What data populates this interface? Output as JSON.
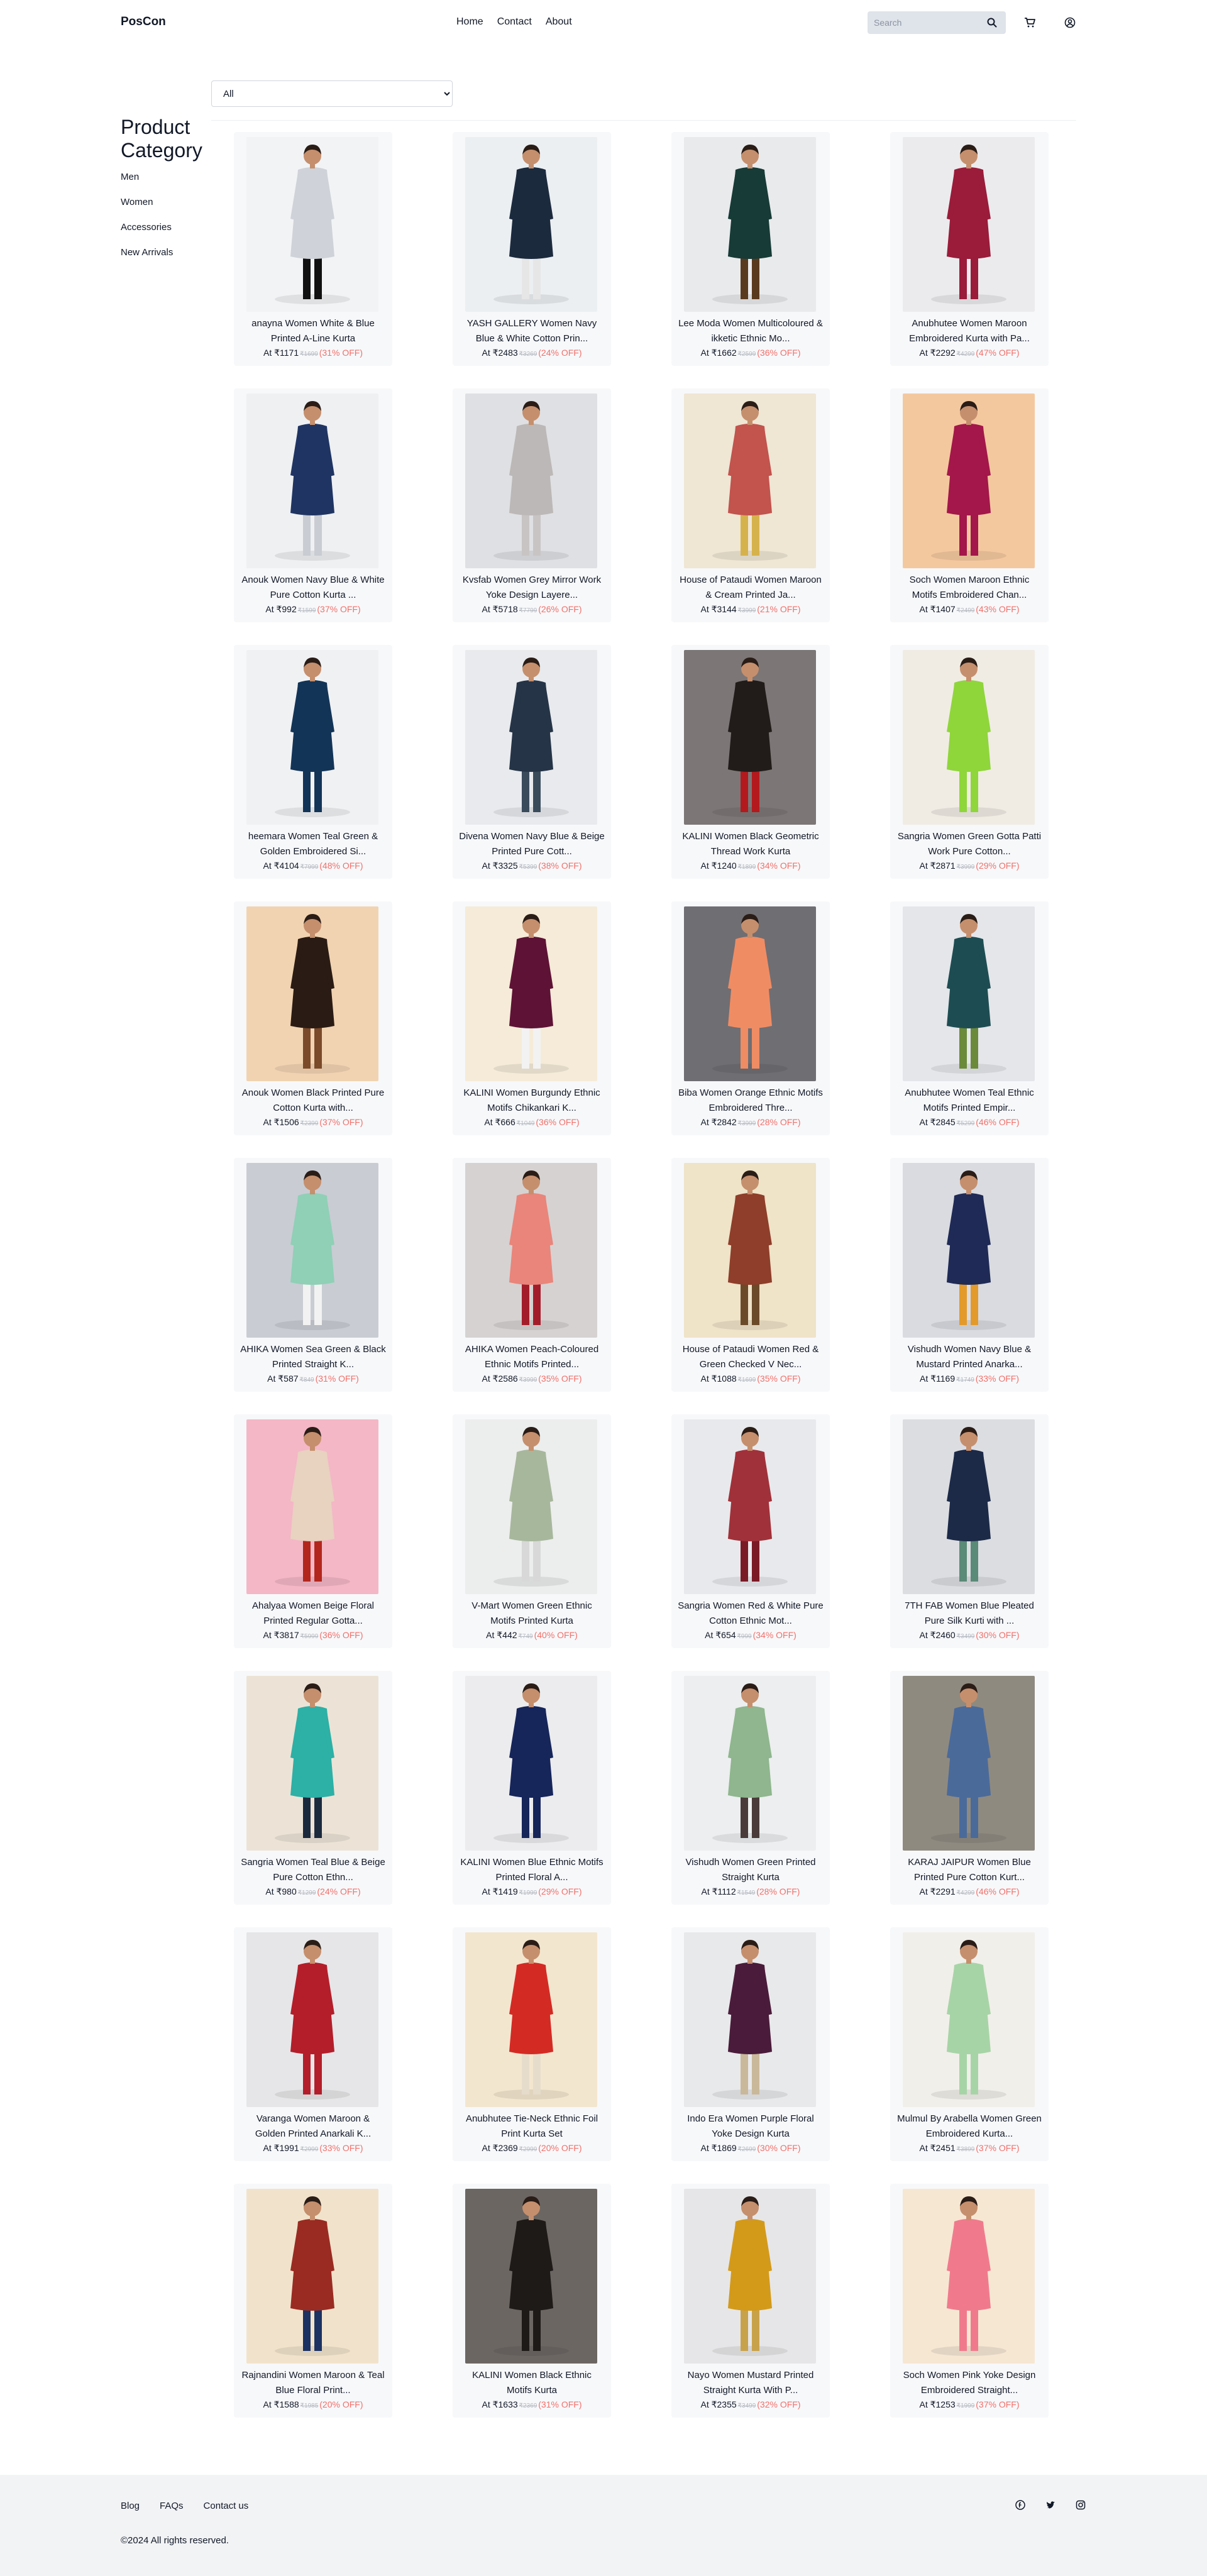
{
  "header": {
    "brand": "PosCon",
    "nav": [
      "Home",
      "Contact",
      "About"
    ],
    "search_placeholder": "Search",
    "icons": [
      "search-icon",
      "cart-icon",
      "user-icon"
    ]
  },
  "filter": {
    "selected": "All"
  },
  "sidebar": {
    "title": "Product Category",
    "items": [
      "Men",
      "Women",
      "Accessories",
      "New Arrivals"
    ]
  },
  "products": [
    {
      "title": "anayna Women White & Blue Printed A-Line Kurta",
      "price": "At ₹1171",
      "mrp": "₹1699",
      "off": "(31% OFF)",
      "colors": [
        "#f2f3f5",
        "#cfd2d8",
        "#111111"
      ]
    },
    {
      "title": "YASH GALLERY Women Navy Blue & White Cotton Prin...",
      "price": "At ₹2483",
      "mrp": "₹3269",
      "off": "(24% OFF)",
      "colors": [
        "#eceff2",
        "#1c2a3e",
        "#e6e6e6"
      ]
    },
    {
      "title": "Lee Moda Women Multicoloured & ikketic Ethnic Mo...",
      "price": "At ₹1662",
      "mrp": "₹2599",
      "off": "(36% OFF)",
      "colors": [
        "#e9eaec",
        "#173b37",
        "#5a3a1e"
      ]
    },
    {
      "title": "Anubhutee Women Maroon Embroidered Kurta with Pa...",
      "price": "At ₹2292",
      "mrp": "₹4299",
      "off": "(47% OFF)",
      "colors": [
        "#ebebed",
        "#9a1b3a",
        "#9a1b3a"
      ]
    },
    {
      "title": "Anouk Women Navy Blue & White Pure Cotton Kurta ...",
      "price": "At ₹992",
      "mrp": "₹1599",
      "off": "(37% OFF)",
      "colors": [
        "#eef0f2",
        "#1f3462",
        "#c9ccd2"
      ]
    },
    {
      "title": "Kvsfab Women Grey Mirror Work Yoke Design Layere...",
      "price": "At ₹5718",
      "mrp": "₹7799",
      "off": "(26% OFF)",
      "colors": [
        "#dfe0e3",
        "#bcb8b7",
        "#c8c4c4"
      ]
    },
    {
      "title": "House of Pataudi Women Maroon & Cream Printed Ja...",
      "price": "At ₹3144",
      "mrp": "₹3999",
      "off": "(21% OFF)",
      "colors": [
        "#efe6d4",
        "#c2534d",
        "#d6b24c"
      ]
    },
    {
      "title": "Soch Women Maroon Ethnic Motifs Embroidered Chan...",
      "price": "At ₹1407",
      "mrp": "₹2499",
      "off": "(43% OFF)",
      "colors": [
        "#f4c89f",
        "#a3174a",
        "#a3174a"
      ]
    },
    {
      "title": "heemara Women Teal Green & Golden Embroidered Si...",
      "price": "At ₹4104",
      "mrp": "₹7999",
      "off": "(48% OFF)",
      "colors": [
        "#f0f1f3",
        "#123457",
        "#123457"
      ]
    },
    {
      "title": "Divena Women Navy Blue & Beige Printed Pure Cott...",
      "price": "At ₹3325",
      "mrp": "₹5399",
      "off": "(38% OFF)",
      "colors": [
        "#e8eaed",
        "#253447",
        "#3a4b5c"
      ]
    },
    {
      "title": "KALINI Women Black Geometric Thread Work Kurta",
      "price": "At ₹1240",
      "mrp": "₹1899",
      "off": "(34% OFF)",
      "colors": [
        "#7c7676",
        "#211c1a",
        "#b3191d"
      ]
    },
    {
      "title": "Sangria Women Green Gotta Patti Work Pure Cotton...",
      "price": "At ₹2871",
      "mrp": "₹3999",
      "off": "(29% OFF)",
      "colors": [
        "#f0ece4",
        "#8fd63a",
        "#8fd63a"
      ]
    },
    {
      "title": "Anouk Women Black Printed Pure Cotton Kurta with...",
      "price": "At ₹1506",
      "mrp": "₹2399",
      "off": "(37% OFF)",
      "colors": [
        "#f1d3b1",
        "#2a1b14",
        "#7b4a2a"
      ]
    },
    {
      "title": "KALINI Women Burgundy Ethnic Motifs Chikankari K...",
      "price": "At ₹666",
      "mrp": "₹1049",
      "off": "(36% OFF)",
      "colors": [
        "#f5ebd8",
        "#5e1235",
        "#f2f2f2"
      ]
    },
    {
      "title": "Biba Women Orange Ethnic Motifs Embroidered Thre...",
      "price": "At ₹2842",
      "mrp": "₹3999",
      "off": "(28% OFF)",
      "colors": [
        "#6f6e73",
        "#f08c63",
        "#f08c63"
      ]
    },
    {
      "title": "Anubhutee Women Teal Ethnic Motifs Printed Empir...",
      "price": "At ₹2845",
      "mrp": "₹5299",
      "off": "(46% OFF)",
      "colors": [
        "#e4e6ea",
        "#1d4d52",
        "#6b8a3a"
      ]
    },
    {
      "title": "AHIKA Women Sea Green & Black Printed Straight K...",
      "price": "At ₹587",
      "mrp": "₹849",
      "off": "(31% OFF)",
      "colors": [
        "#c9ccd3",
        "#8fd0b6",
        "#f2f2f2"
      ]
    },
    {
      "title": "AHIKA Women Peach-Coloured Ethnic Motifs Printed...",
      "price": "At ₹2586",
      "mrp": "₹3999",
      "off": "(35% OFF)",
      "colors": [
        "#d6d2d2",
        "#e9857a",
        "#a31c2a"
      ]
    },
    {
      "title": "House of Pataudi Women Red & Green Checked V Nec...",
      "price": "At ₹1088",
      "mrp": "₹1699",
      "off": "(35% OFF)",
      "colors": [
        "#efe3c8",
        "#8e3e2a",
        "#6b4a2a"
      ]
    },
    {
      "title": "Vishudh Women Navy Blue & Mustard Printed Anarka...",
      "price": "At ₹1169",
      "mrp": "₹1749",
      "off": "(33% OFF)",
      "colors": [
        "#d9dbe0",
        "#1f2a56",
        "#e39a2a"
      ]
    },
    {
      "title": "Ahalyaa Women Beige Floral Printed Regular Gotta...",
      "price": "At ₹3817",
      "mrp": "₹5999",
      "off": "(36% OFF)",
      "colors": [
        "#f4b7c6",
        "#e8d2c0",
        "#b3261e"
      ]
    },
    {
      "title": "V-Mart Women Green Ethnic Motifs Printed Kurta",
      "price": "At ₹442",
      "mrp": "₹749",
      "off": "(40% OFF)",
      "colors": [
        "#eceded",
        "#a7b79c",
        "#d8d8d8"
      ]
    },
    {
      "title": "Sangria Women Red & White Pure Cotton Ethnic Mot...",
      "price": "At ₹654",
      "mrp": "₹999",
      "off": "(34% OFF)",
      "colors": [
        "#e8e9ec",
        "#a0313a",
        "#7a1a25"
      ]
    },
    {
      "title": "7TH FAB Women Blue Pleated Pure Silk Kurti with ...",
      "price": "At ₹2460",
      "mrp": "₹3499",
      "off": "(30% OFF)",
      "colors": [
        "#dcdde1",
        "#1c2a48",
        "#5a8a78"
      ]
    },
    {
      "title": "Sangria Women Teal Blue & Beige Pure Cotton Ethn...",
      "price": "At ₹980",
      "mrp": "₹1299",
      "off": "(24% OFF)",
      "colors": [
        "#ece3d6",
        "#2db0a6",
        "#1c2a3e"
      ]
    },
    {
      "title": "KALINI Women Blue Ethnic Motifs Printed Floral A...",
      "price": "At ₹1419",
      "mrp": "₹1999",
      "off": "(29% OFF)",
      "colors": [
        "#ececee",
        "#16255a",
        "#16255a"
      ]
    },
    {
      "title": "Vishudh Women Green Printed Straight Kurta",
      "price": "At ₹1112",
      "mrp": "₹1549",
      "off": "(28% OFF)",
      "colors": [
        "#eceeef",
        "#8fb68e",
        "#4a3a3a"
      ]
    },
    {
      "title": "KARAJ JAIPUR Women Blue Printed Pure Cotton Kurt...",
      "price": "At ₹2291",
      "mrp": "₹4299",
      "off": "(46% OFF)",
      "colors": [
        "#8f8a80",
        "#4a6a9a",
        "#4a6a9a"
      ]
    },
    {
      "title": "Varanga Women Maroon & Golden Printed Anarkali K...",
      "price": "At ₹1991",
      "mrp": "₹2999",
      "off": "(33% OFF)",
      "colors": [
        "#e6e6e8",
        "#b31e2a",
        "#b31e2a"
      ]
    },
    {
      "title": "Anubhutee Tie-Neck Ethnic Foil Print Kurta Set",
      "price": "At ₹2369",
      "mrp": "₹2999",
      "off": "(20% OFF)",
      "colors": [
        "#f3e6cf",
        "#d42a24",
        "#e6dccb"
      ]
    },
    {
      "title": "Indo Era Women Purple Floral Yoke Design Kurta",
      "price": "At ₹1869",
      "mrp": "₹2699",
      "off": "(30% OFF)",
      "colors": [
        "#e8e9eb",
        "#4a1b3a",
        "#c9b89a"
      ]
    },
    {
      "title": "Mulmul By Arabella Women Green Embroidered Kurta...",
      "price": "At ₹2451",
      "mrp": "₹3899",
      "off": "(37% OFF)",
      "colors": [
        "#f1efe9",
        "#a7d4a7",
        "#a7d4a7"
      ]
    },
    {
      "title": "Rajnandini Women Maroon & Teal Blue Floral Print...",
      "price": "At ₹1588",
      "mrp": "₹1985",
      "off": "(20% OFF)",
      "colors": [
        "#f1e3cb",
        "#9a2b22",
        "#1c3262"
      ]
    },
    {
      "title": "KALINI Women Black Ethnic Motifs Kurta",
      "price": "At ₹1633",
      "mrp": "₹2369",
      "off": "(31% OFF)",
      "colors": [
        "#6c6663",
        "#1e1a18",
        "#1e1a18"
      ]
    },
    {
      "title": "Nayo Women Mustard Printed Straight Kurta With P...",
      "price": "At ₹2355",
      "mrp": "₹3499",
      "off": "(32% OFF)",
      "colors": [
        "#e6e6e8",
        "#d39a1a",
        "#c8a24a"
      ]
    },
    {
      "title": "Soch Women Pink Yoke Design Embroidered Straight...",
      "price": "At ₹1253",
      "mrp": "₹1999",
      "off": "(37% OFF)",
      "colors": [
        "#f6e7d3",
        "#f07a8c",
        "#f07a8c"
      ]
    }
  ],
  "footer": {
    "links": [
      "Blog",
      "FAQs",
      "Contact us"
    ],
    "copyright": "©2024 All rights reserved.",
    "social": [
      "facebook-icon",
      "twitter-icon",
      "instagram-icon"
    ]
  }
}
